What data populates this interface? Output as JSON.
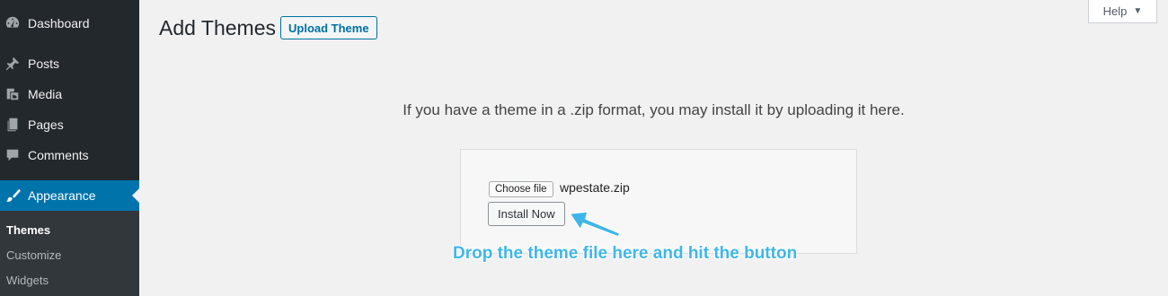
{
  "sidebar": {
    "items": [
      {
        "label": "Dashboard",
        "icon": "dashboard-icon"
      },
      {
        "label": "Posts",
        "icon": "pin-icon"
      },
      {
        "label": "Media",
        "icon": "media-icon"
      },
      {
        "label": "Pages",
        "icon": "pages-icon"
      },
      {
        "label": "Comments",
        "icon": "comment-icon"
      },
      {
        "label": "Appearance",
        "icon": "paintbrush-icon",
        "active": true
      }
    ],
    "submenu": [
      {
        "label": "Themes",
        "current": true
      },
      {
        "label": "Customize"
      },
      {
        "label": "Widgets"
      }
    ]
  },
  "header": {
    "title": "Add Themes",
    "upload_button": "Upload Theme",
    "help_tab": "Help"
  },
  "upload": {
    "instructions": "If you have a theme in a .zip format, you may install it by uploading it here.",
    "choose_file_label": "Choose file",
    "file_name": "wpestate.zip",
    "install_button": "Install Now"
  },
  "annotation": {
    "text": "Drop the theme file here and hit the button"
  },
  "colors": {
    "sidebar_bg": "#23282d",
    "active_bg": "#0073aa",
    "accent": "#0071a1",
    "annotation": "#3fb6ea"
  }
}
